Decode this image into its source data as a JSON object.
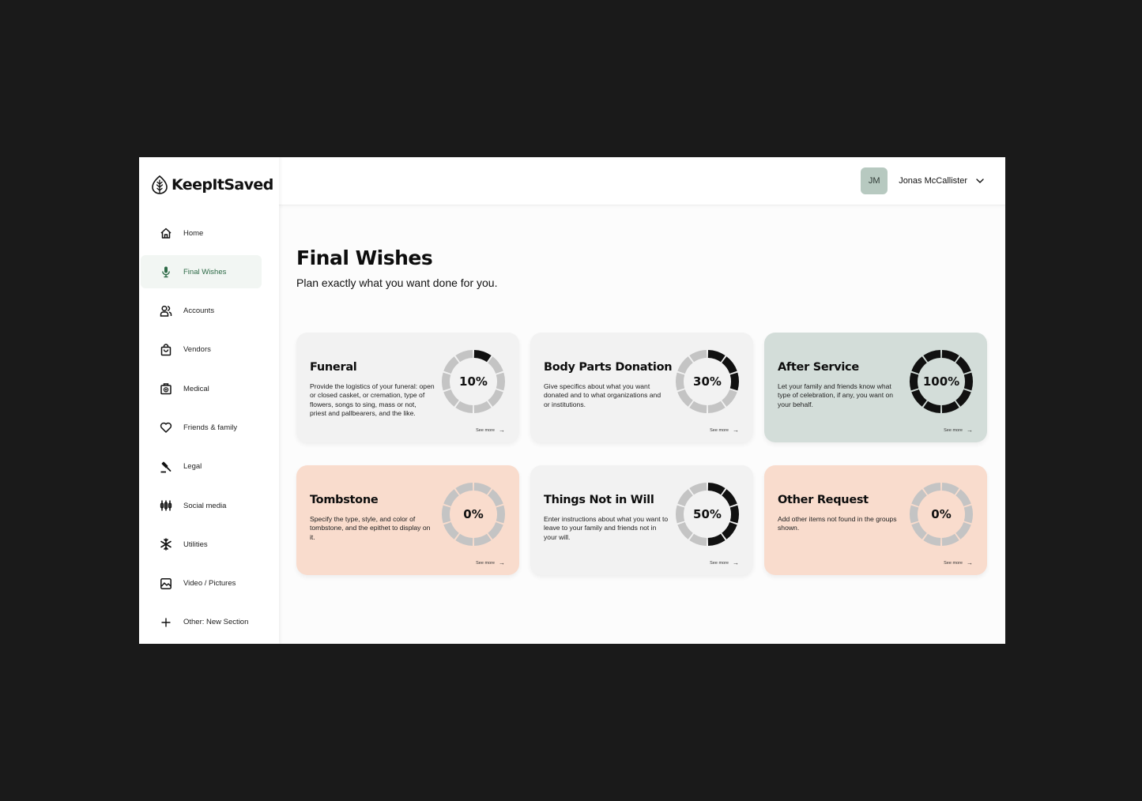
{
  "brand": {
    "name": "KeepItSaved"
  },
  "sidebar": {
    "items": [
      {
        "label": "Home",
        "icon": "home-icon",
        "active": false
      },
      {
        "label": "Final Wishes",
        "icon": "microphone-icon",
        "active": true
      },
      {
        "label": "Accounts",
        "icon": "users-icon",
        "active": false
      },
      {
        "label": "Vendors",
        "icon": "shopping-bag-icon",
        "active": false
      },
      {
        "label": "Medical",
        "icon": "medical-kit-icon",
        "active": false
      },
      {
        "label": "Friends & family",
        "icon": "heart-icon",
        "active": false
      },
      {
        "label": "Legal",
        "icon": "gavel-icon",
        "active": false
      },
      {
        "label": "Social media",
        "icon": "social-icon",
        "active": false
      },
      {
        "label": "Utilities",
        "icon": "snowflake-icon",
        "active": false
      },
      {
        "label": "Video / Pictures",
        "icon": "image-icon",
        "active": false
      },
      {
        "label": "Other: New Section",
        "icon": "plus-icon",
        "active": false
      }
    ]
  },
  "header": {
    "avatar_initials": "JM",
    "user_name": "Jonas McCallister"
  },
  "page": {
    "title": "Final Wishes",
    "subtitle": "Plan exactly what you want done for you."
  },
  "cards": [
    {
      "title": "Funeral",
      "description": "Provide the logistics of your funeral: open or closed casket, or cremation, type of flowers, songs to sing, mass or not, priest and pallbearers, and the like.",
      "progress": 10,
      "progress_label": "10%",
      "see_more": "See more",
      "theme": "grey"
    },
    {
      "title": "Body Parts Donation",
      "description": "Give specifics about what you want donated and to what organizations and or institutions.",
      "progress": 30,
      "progress_label": "30%",
      "see_more": "See more",
      "theme": "grey"
    },
    {
      "title": "After Service",
      "description": "Let your family and friends know what type of celebration, if any, you want on your behalf.",
      "progress": 100,
      "progress_label": "100%",
      "see_more": "See more",
      "theme": "sage"
    },
    {
      "title": "Tombstone",
      "description": "Specify the type, style, and color of tombstone, and the epithet to display on it.",
      "progress": 0,
      "progress_label": "0%",
      "see_more": "See more",
      "theme": "peach"
    },
    {
      "title": "Things Not in Will",
      "description": "Enter instructions about what you want to leave to your family and friends not in your will.",
      "progress": 50,
      "progress_label": "50%",
      "see_more": "See more",
      "theme": "grey"
    },
    {
      "title": "Other Request",
      "description": "Add other items not found in the groups shown.",
      "progress": 0,
      "progress_label": "0%",
      "see_more": "See more",
      "theme": "peach"
    }
  ],
  "colors": {
    "ring_filled": "#111111",
    "ring_empty": "#c4c4c4",
    "active_nav": "#2e6b47",
    "card_grey": "#f2f2f2",
    "card_sage": "#d3ddd9",
    "card_peach": "#f9dccd"
  }
}
